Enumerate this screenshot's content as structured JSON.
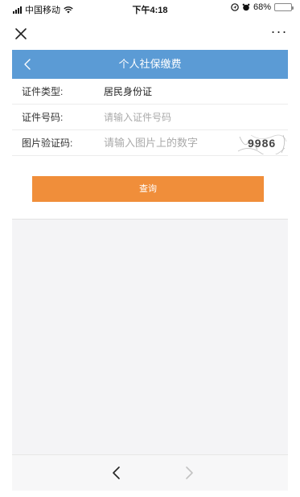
{
  "status_bar": {
    "carrier": "中国移动",
    "time": "下午4:18",
    "battery_percent": "68%",
    "battery_level": 0.68,
    "icons": [
      "signal-icon",
      "wifi-icon",
      "location-icon",
      "alarm-icon",
      "battery-icon"
    ]
  },
  "top_bar": {
    "close_icon": "close-icon",
    "more_label": "···"
  },
  "header": {
    "title": "个人社保缴费",
    "back_icon": "chevron-left-icon",
    "color": "#5b9bd5"
  },
  "form": {
    "id_type": {
      "label": "证件类型:",
      "value": "居民身份证"
    },
    "id_number": {
      "label": "证件号码:",
      "placeholder": "请输入证件号码"
    },
    "captcha": {
      "label": "图片验证码:",
      "placeholder": "请输入图片上的数字",
      "image_text": "9986"
    }
  },
  "query_button": {
    "label": "查询",
    "color": "#f08e3a"
  },
  "bottom_nav": {
    "back_icon": "chevron-left-icon",
    "forward_icon": "chevron-right-icon"
  }
}
